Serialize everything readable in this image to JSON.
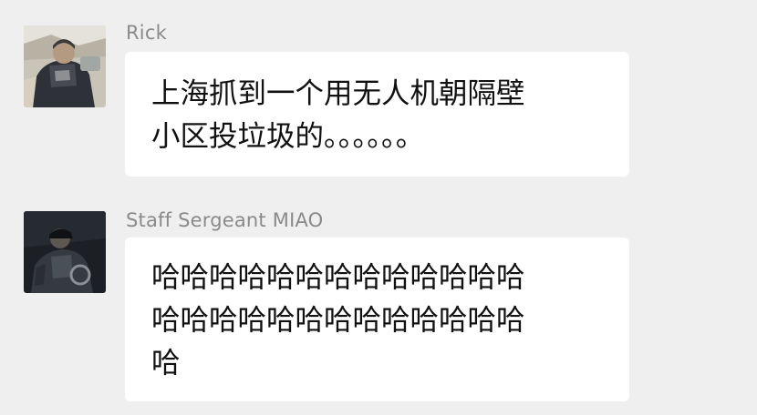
{
  "messages": [
    {
      "sender": "Rick",
      "avatar_icon": "user-avatar-photo-icon",
      "lines": [
        "上海抓到一个用无人机朝隔壁",
        "小区投垃圾的。。。。。。"
      ]
    },
    {
      "sender": "Staff Sergeant MIAO",
      "avatar_icon": "user-avatar-photo-icon",
      "lines": [
        "哈哈哈哈哈哈哈哈哈哈哈哈哈",
        "哈哈哈哈哈哈哈哈哈哈哈哈哈",
        "哈"
      ]
    }
  ],
  "colors": {
    "background": "#efefef",
    "bubble": "#ffffff",
    "sender_name": "#8a8a8a",
    "message_text": "#111111"
  }
}
